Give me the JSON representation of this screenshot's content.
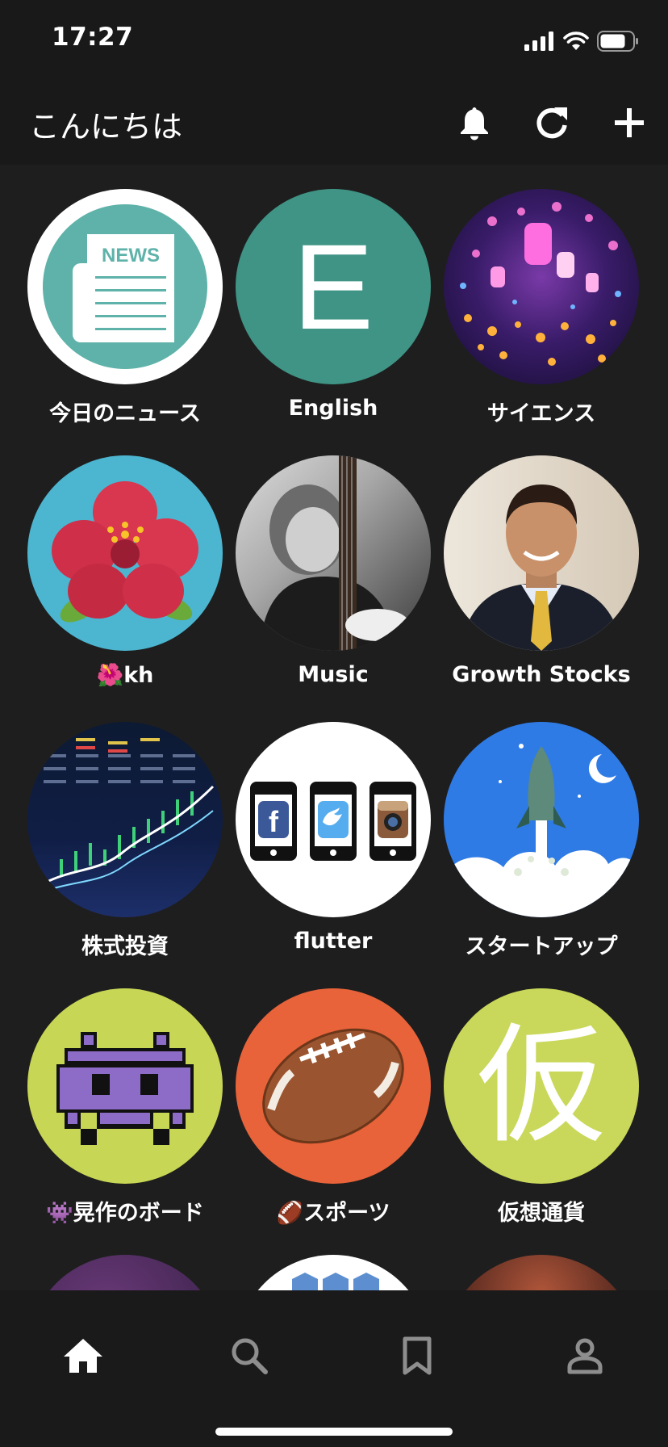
{
  "status_bar": {
    "time": "17:27"
  },
  "header": {
    "greeting": "こんにちは",
    "icons": [
      "bell-icon",
      "refresh-icon",
      "plus-icon"
    ]
  },
  "tiles": [
    {
      "label": "今日のニュース",
      "news_text": "NEWS",
      "color": "#5eb2a9"
    },
    {
      "label": "English",
      "letter": "E",
      "color": "#3f9485"
    },
    {
      "label": "サイエンス"
    },
    {
      "label": "🌺kh",
      "color": "#4cb5d0"
    },
    {
      "label": "Music"
    },
    {
      "label": "Growth Stocks"
    },
    {
      "label": "株式投資"
    },
    {
      "label": "flutter"
    },
    {
      "label": "スタートアップ",
      "color": "#2f7be6"
    },
    {
      "label": "👾晃作のボード",
      "color": "#c8d655"
    },
    {
      "label": "🏈スポーツ",
      "color": "#e8633a"
    },
    {
      "label": "仮想通貨",
      "letter": "仮",
      "color": "#c9d85a"
    }
  ],
  "bottom_nav": {
    "items": [
      "home-icon",
      "search-icon",
      "bookmark-icon",
      "profile-icon"
    ],
    "active": "home-icon"
  }
}
